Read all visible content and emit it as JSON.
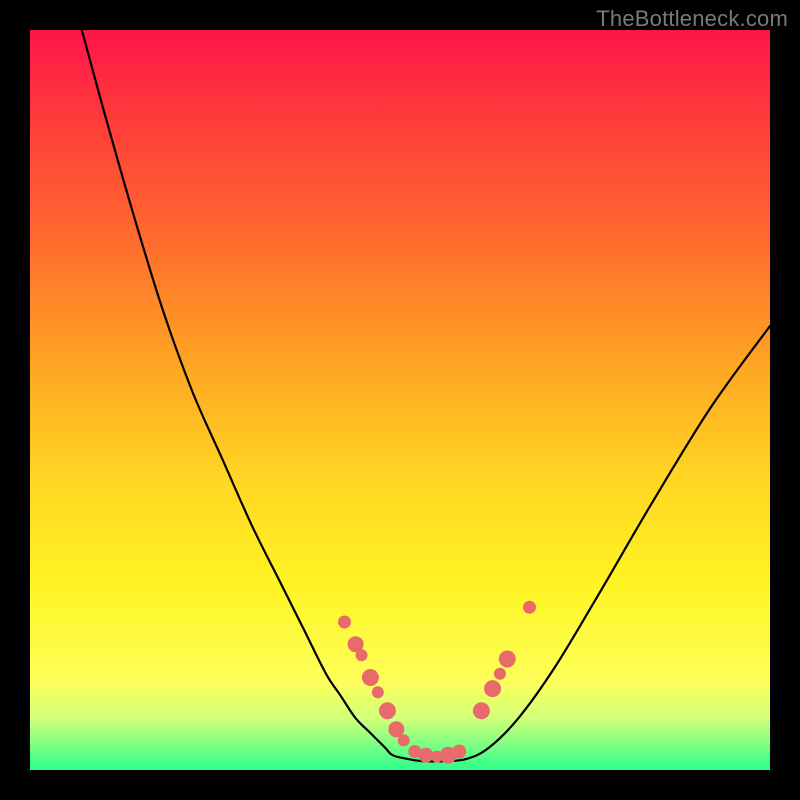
{
  "watermark": "TheBottleneck.com",
  "colors": {
    "line": "#000000",
    "dot": "#e86a6a",
    "frame_border": "#000000"
  },
  "chart_data": {
    "type": "line",
    "title": "",
    "xlabel": "",
    "ylabel": "",
    "xlim": [
      0,
      100
    ],
    "ylim": [
      0,
      100
    ],
    "grid": false,
    "legend": false,
    "series": [
      {
        "name": "left-curve",
        "x": [
          7,
          10,
          14,
          18,
          22,
          26,
          30,
          34,
          37,
          40,
          42,
          44,
          46,
          48,
          49
        ],
        "y": [
          100,
          89,
          75,
          62,
          51,
          42,
          33,
          25,
          19,
          13,
          10,
          7,
          5,
          3,
          2
        ]
      },
      {
        "name": "floor",
        "x": [
          49,
          51,
          53,
          56,
          59
        ],
        "y": [
          2,
          1.5,
          1.2,
          1.2,
          1.5
        ]
      },
      {
        "name": "right-curve",
        "x": [
          59,
          62,
          66,
          71,
          77,
          84,
          92,
          100
        ],
        "y": [
          1.5,
          3,
          7,
          14,
          24,
          36,
          49,
          60
        ]
      }
    ],
    "markers": {
      "name": "dots",
      "x": [
        42.5,
        44.0,
        44.8,
        46.0,
        47.0,
        48.3,
        49.5,
        50.5,
        52.0,
        53.5,
        55.0,
        56.5,
        58.0,
        61.0,
        62.5,
        63.5,
        64.5,
        67.5
      ],
      "y": [
        20.0,
        17.0,
        15.5,
        12.5,
        10.5,
        8.0,
        5.5,
        4.0,
        2.5,
        2.0,
        1.8,
        2.0,
        2.5,
        8.0,
        11.0,
        13.0,
        15.0,
        22.0
      ],
      "r": [
        6.5,
        8.0,
        6.0,
        8.5,
        6.0,
        8.5,
        8.0,
        6.0,
        6.5,
        7.5,
        6.0,
        8.5,
        7.0,
        8.5,
        8.5,
        6.0,
        8.5,
        6.5
      ]
    }
  }
}
